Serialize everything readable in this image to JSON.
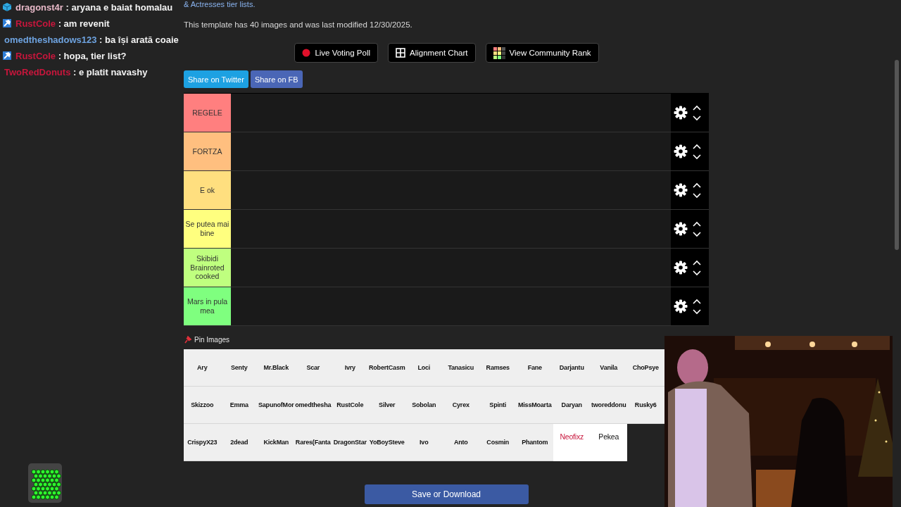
{
  "chat": {
    "messages": [
      {
        "kind": "cube",
        "user": "dragonst4r",
        "color": "#e8b9c8",
        "text": ": aryana e baiat homalau"
      },
      {
        "kind": "hammer",
        "user": "RustCole",
        "color": "#c8163c",
        "text": ": am revenit"
      },
      {
        "kind": "plain",
        "user": "omedtheshadows123",
        "color": "#6ea3e0",
        "text": ": ba își arată coaie"
      },
      {
        "kind": "hammer",
        "user": "RustCole",
        "color": "#c8163c",
        "text": ": hopa, tier list?"
      },
      {
        "kind": "plain",
        "user": "TwoRedDonuts",
        "color": "#c8163c",
        "text": ": e platit navashy"
      }
    ]
  },
  "header": {
    "link": "& Actresses tier lists.",
    "info": "This template has 40 images and was last modified 12/30/2025."
  },
  "actions": [
    {
      "kind": "record",
      "label": "Live Voting Poll"
    },
    {
      "kind": "grid",
      "label": "Alignment Chart"
    },
    {
      "kind": "rank",
      "label": "View Community Rank"
    }
  ],
  "share": [
    {
      "kind": "twitter",
      "label": "Share on Twitter"
    },
    {
      "kind": "facebook",
      "label": "Share on FB"
    }
  ],
  "tiers": [
    {
      "label": "REGELE",
      "color": "#ff7f7f"
    },
    {
      "label": "FORTZA",
      "color": "#ffbf7f"
    },
    {
      "label": "E ok",
      "color": "#ffdf7f"
    },
    {
      "label": "Se putea mai bine",
      "color": "#ffff7f"
    },
    {
      "label": "Skibidi Brainroted cooked",
      "color": "#bfff7f"
    },
    {
      "label": "Mars in pula mea",
      "color": "#7fff7f"
    }
  ],
  "pin_images": {
    "label": "Pin Images"
  },
  "pool": [
    {
      "kind": "text",
      "label": "Ary"
    },
    {
      "kind": "text",
      "label": "Senty"
    },
    {
      "kind": "text",
      "label": "Mr.Black"
    },
    {
      "kind": "text",
      "label": "Scar"
    },
    {
      "kind": "text",
      "label": "Ivry"
    },
    {
      "kind": "text",
      "label": "RobertCasm"
    },
    {
      "kind": "text",
      "label": "Loci"
    },
    {
      "kind": "text",
      "label": "Tanasicu"
    },
    {
      "kind": "text",
      "label": "Ramses"
    },
    {
      "kind": "text",
      "label": "Fane"
    },
    {
      "kind": "text",
      "label": "Darjantu"
    },
    {
      "kind": "text",
      "label": "Vanila"
    },
    {
      "kind": "text",
      "label": "ChoPsye"
    },
    {
      "kind": "text",
      "label": "Skizzoo"
    },
    {
      "kind": "text",
      "label": "Emma"
    },
    {
      "kind": "text",
      "label": "SapunofMor"
    },
    {
      "kind": "text",
      "label": "omedthesha"
    },
    {
      "kind": "text",
      "label": "RustCole"
    },
    {
      "kind": "text",
      "label": "Silver"
    },
    {
      "kind": "text",
      "label": "Sobolan"
    },
    {
      "kind": "text",
      "label": "Cyrex"
    },
    {
      "kind": "text",
      "label": "Spinti"
    },
    {
      "kind": "text",
      "label": "MissMoarta"
    },
    {
      "kind": "text",
      "label": "Daryan"
    },
    {
      "kind": "text",
      "label": "tworeddonu"
    },
    {
      "kind": "text",
      "label": "Rusky6"
    },
    {
      "kind": "text",
      "label": "CrispyX23"
    },
    {
      "kind": "text",
      "label": "2dead"
    },
    {
      "kind": "text",
      "label": "KickMan"
    },
    {
      "kind": "text",
      "label": "Rares(Fanta"
    },
    {
      "kind": "text",
      "label": "DragonStar"
    },
    {
      "kind": "text",
      "label": "YoBoySteve"
    },
    {
      "kind": "text",
      "label": "Ivo"
    },
    {
      "kind": "text",
      "label": "Anto"
    },
    {
      "kind": "text",
      "label": "Cosmin"
    },
    {
      "kind": "text",
      "label": "Phantom"
    },
    {
      "kind": "card",
      "label": "Neofixz",
      "color": "#c8163c"
    },
    {
      "kind": "card",
      "label": "Pekea",
      "color": "#111111"
    }
  ],
  "save_button": {
    "label": "Save or Download"
  }
}
